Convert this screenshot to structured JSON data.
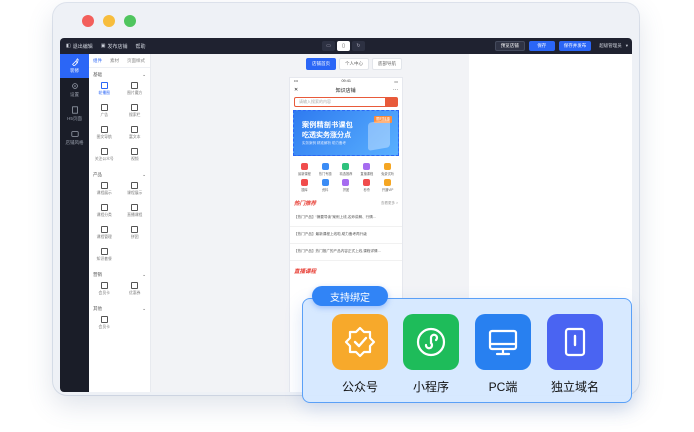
{
  "window": {
    "dot_colors": [
      "#f35f5b",
      "#f7bd3c",
      "#4fc55e"
    ]
  },
  "topbar": {
    "left_items": [
      "退出编辑",
      "发布店铺",
      "帮助"
    ],
    "device_icons": [
      "desktop-icon",
      "mobile-icon",
      "refresh-icon"
    ],
    "buttons": [
      {
        "label": "预览店铺",
        "style": "dark"
      },
      {
        "label": "保存",
        "style": "primary"
      },
      {
        "label": "保存并发布",
        "style": "primary"
      }
    ],
    "user": "超级管理员"
  },
  "iconbar": [
    {
      "label": "装修",
      "icon": "brush-icon",
      "active": true
    },
    {
      "label": "设置",
      "icon": "gear-icon",
      "active": false
    },
    {
      "label": "H5页面",
      "icon": "page-icon",
      "active": false
    },
    {
      "label": "店铺风格",
      "icon": "palette-icon",
      "active": false
    }
  ],
  "panel": {
    "tabs": [
      "组件",
      "素材",
      "页面样式"
    ],
    "active_tab": "组件",
    "sections": [
      {
        "title": "基础",
        "items": [
          "轮播图",
          "图片魔方",
          "广告",
          "搜索栏",
          "图文导航",
          "富文本",
          "关注公众号",
          "视频"
        ],
        "active": "轮播图"
      },
      {
        "title": "产品",
        "items": [
          "课程展示",
          "课程展示",
          "课程分类",
          "直播课程",
          "课程管理",
          "拼团",
          "知识套餐"
        ]
      },
      {
        "title": "营销",
        "items": [
          "会员卡",
          "优惠券"
        ]
      },
      {
        "title": "其他",
        "items": [
          "会员卡"
        ]
      }
    ]
  },
  "center_tabs": {
    "items": [
      "店铺首页",
      "个人中心",
      "底部导航"
    ],
    "active": "店铺首页"
  },
  "phone": {
    "status_time": "09:41",
    "title": "知识店铺",
    "search_placeholder": "请输入搜索的内容",
    "banner": {
      "line1": "案例精剖书课包",
      "line2": "吃透实务涨分点",
      "line3": "实务案例 精准解析 助力备考",
      "tag": "限时特惠"
    },
    "quick_icons": [
      {
        "label": "最新课程",
        "color": "#f04c4c"
      },
      {
        "label": "热门专题",
        "color": "#3b8cf5"
      },
      {
        "label": "精选推荐",
        "color": "#2fc27d"
      },
      {
        "label": "直播课程",
        "color": "#a66cf0"
      },
      {
        "label": "免费试听",
        "color": "#f5a623"
      },
      {
        "label": "题库",
        "color": "#f04c4c"
      },
      {
        "label": "资料",
        "color": "#3b8cf5"
      },
      {
        "label": "拼团",
        "color": "#a66cf0"
      },
      {
        "label": "秒杀",
        "color": "#f04c4c"
      },
      {
        "label": "开通VIP",
        "color": "#f5a623"
      }
    ],
    "hot_title": "热门推荐",
    "more": "查看更多 >",
    "news": [
      "【热门产品】“摘要导读”案例上线,名师讲解、行情…",
      "【热门产品】最新课程上线啦,助力备考再升级",
      "【热门产品】热门推广的产品内容正式上线,课程详情…"
    ],
    "hot2_title": "直播课程"
  },
  "overlay": {
    "pill": "支持绑定",
    "features": [
      {
        "label": "公众号",
        "color": "#f5a623",
        "icon": "official-account-icon"
      },
      {
        "label": "小程序",
        "color": "#1ebc5a",
        "icon": "mini-program-icon"
      },
      {
        "label": "PC端",
        "color": "#2880f0",
        "icon": "pc-monitor-icon"
      },
      {
        "label": "独立域名",
        "color": "#4a64f2",
        "icon": "tablet-domain-icon"
      }
    ]
  }
}
